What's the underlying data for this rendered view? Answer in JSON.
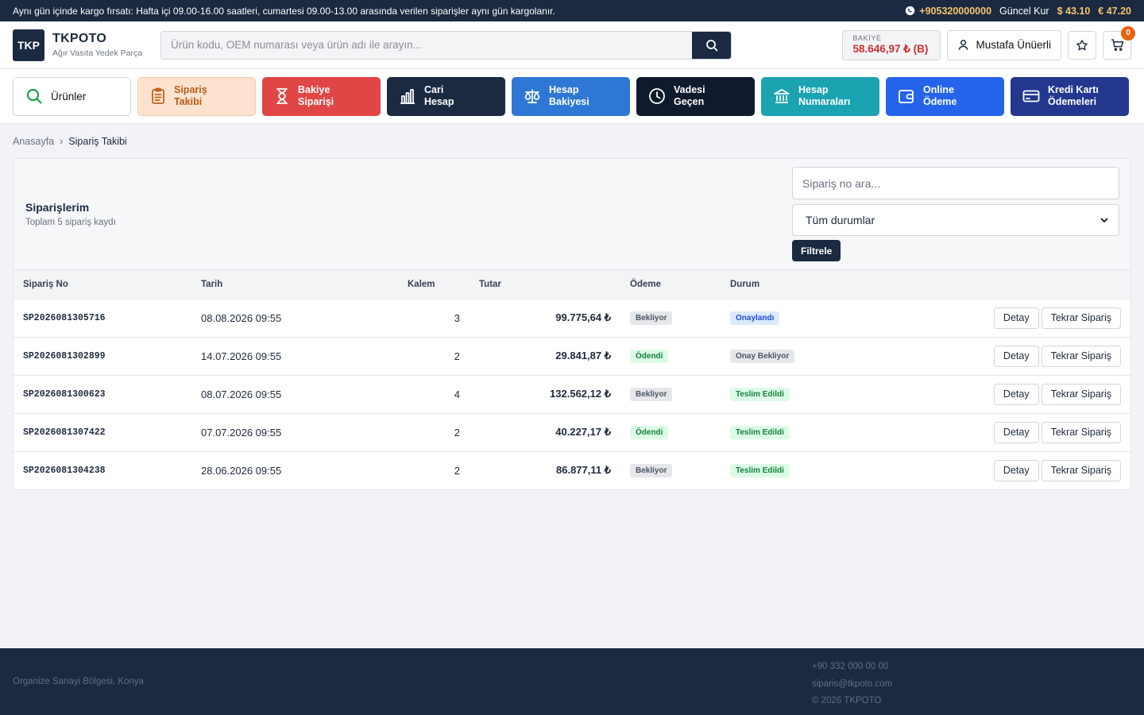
{
  "topbar": {
    "announcement": "Aynı gün içinde kargo fırsatı: Hafta içi 09.00-16.00 saatleri, cumartesi 09.00-13.00 arasında verilen siparişler aynı gün kargolanır.",
    "phone": "+905320000000",
    "rate_label": "Güncel Kur",
    "usd": "$ 43.10",
    "eur": "€ 47.20"
  },
  "header": {
    "logo_text": "TKP",
    "brand_name": "TKPOTO",
    "brand_tagline": "Ağır Vasıta Yedek Parça",
    "search_placeholder": "Ürün kodu, OEM numarası veya ürün adı ile arayın...",
    "balance_label": "BAKİYE",
    "balance_value": "58.646,97 ₺ (B)",
    "user_name": "Mustafa Ünüerli",
    "cart_count": "0"
  },
  "nav": [
    {
      "id": "urunler",
      "line1": "Ürünler",
      "line2": "",
      "icon": "search-icon"
    },
    {
      "id": "siparis-takibi",
      "line1": "Sipariş",
      "line2": "Takibi",
      "icon": "clipboard-icon"
    },
    {
      "id": "bakiye-siparisi",
      "line1": "Bakiye",
      "line2": "Siparişi",
      "icon": "hourglass-icon"
    },
    {
      "id": "cari-hesap",
      "line1": "Cari",
      "line2": "Hesap",
      "icon": "bar-chart-icon"
    },
    {
      "id": "hesap-bakiyesi",
      "line1": "Hesap",
      "line2": "Bakiyesi",
      "icon": "scale-icon"
    },
    {
      "id": "vadesi-gecen",
      "line1": "Vadesi",
      "line2": "Geçen",
      "icon": "clock-icon"
    },
    {
      "id": "hesap-numaralari",
      "line1": "Hesap",
      "line2": "Numaraları",
      "icon": "bank-icon"
    },
    {
      "id": "online-odeme",
      "line1": "Online",
      "line2": "Ödeme",
      "icon": "wallet-icon"
    },
    {
      "id": "kredi-karti",
      "line1": "Kredi Kartı",
      "line2": "Ödemeleri",
      "icon": "credit-card-icon"
    }
  ],
  "breadcrumb": {
    "home": "Anasayfa",
    "separator": "›",
    "current": "Sipariş Takibi"
  },
  "orders": {
    "title": "Siparişlerim",
    "subtitle": "Toplam 5 sipariş kaydı",
    "search_placeholder": "Sipariş no ara...",
    "status_filter": "Tüm durumlar",
    "filter_button": "Filtrele",
    "columns": {
      "no": "Sipariş No",
      "date": "Tarih",
      "items": "Kalem",
      "amount": "Tutar",
      "payment": "Ödeme",
      "status": "Durum"
    },
    "detail_label": "Detay",
    "reorder_label": "Tekrar Sipariş",
    "rows": [
      {
        "no": "SP2026081305716",
        "date": "08.08.2026 09:55",
        "items": "3",
        "amount": "99.775,64 ₺",
        "payment": "Bekliyor",
        "status": "Onaylandı"
      },
      {
        "no": "SP2026081302899",
        "date": "14.07.2026 09:55",
        "items": "2",
        "amount": "29.841,87 ₺",
        "payment": "Ödendi",
        "status": "Onay Bekliyor"
      },
      {
        "no": "SP2026081300623",
        "date": "08.07.2026 09:55",
        "items": "4",
        "amount": "132.562,12 ₺",
        "payment": "Bekliyor",
        "status": "Teslim Edildi"
      },
      {
        "no": "SP2026081307422",
        "date": "07.07.2026 09:55",
        "items": "2",
        "amount": "40.227,17 ₺",
        "payment": "Ödendi",
        "status": "Teslim Edildi"
      },
      {
        "no": "SP2026081304238",
        "date": "28.06.2026 09:55",
        "items": "2",
        "amount": "86.877,11 ₺",
        "payment": "Bekliyor",
        "status": "Teslim Edildi"
      }
    ]
  },
  "footer": {
    "address": "Organize Sanayi Bölgesi, Konya",
    "phone": "+90 332 000 00 00",
    "email": "siparis@tkpoto.com",
    "copyright": "© 2026 TKPOTO"
  },
  "colors": {
    "navy": "#1b2a41",
    "accent_orange": "#e8620f",
    "balance_red": "#d12f2f",
    "rate_gold": "#f7c46c",
    "bakiye_red": "#e04646",
    "hesap_blue": "#2f77d4",
    "teal": "#1aa3b1",
    "online_blue": "#2563eb",
    "kredi_indigo": "#23378f"
  }
}
